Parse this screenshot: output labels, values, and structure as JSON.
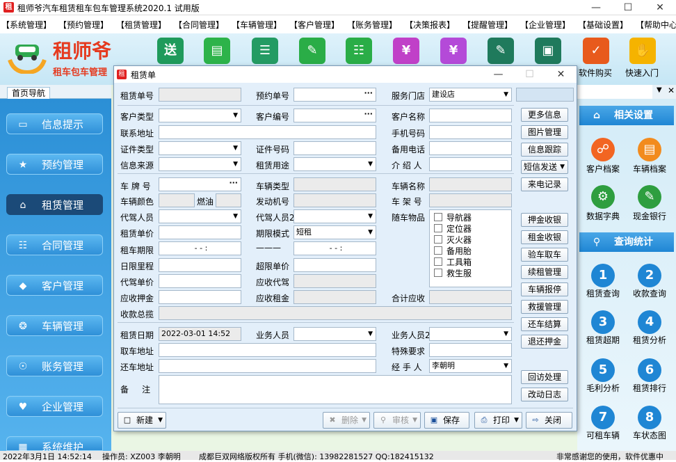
{
  "app": {
    "title": "租师爷汽车租赁租车包车管理系统2020.1 试用版"
  },
  "menu": [
    "【系统管理】",
    "【预约管理】",
    "【租赁管理】",
    "【合同管理】",
    "【车辆管理】",
    "【客户管理】",
    "【账务管理】",
    "【决策报表】",
    "【提醒管理】",
    "【企业管理】",
    "【基础设置】",
    "【帮助中心"
  ],
  "logo": {
    "name": "租师爷",
    "slogan": "租车包车管理"
  },
  "toolbar": {
    "buy": "软件购买",
    "guide": "快速入门"
  },
  "left": {
    "tab": "首页导航",
    "items": [
      "信息提示",
      "预约管理",
      "租赁管理",
      "合同管理",
      "客户管理",
      "车辆管理",
      "账务管理",
      "企业管理",
      "系统维护"
    ]
  },
  "right": {
    "settings": "相关设置",
    "stats": "查询统计",
    "settings_items": [
      "客户档案",
      "车辆档案",
      "数据字典",
      "现金银行"
    ],
    "stats_items": [
      "租赁查询",
      "收款查询",
      "租赁超期",
      "租赁分析",
      "毛利分析",
      "租赁排行",
      "可租车辆",
      "车状态图"
    ],
    "nums": [
      "1",
      "2",
      "3",
      "4",
      "5",
      "6",
      "7",
      "8"
    ]
  },
  "dialog": {
    "title": "租赁单",
    "labels": {
      "lease_no": "租赁单号",
      "reserve_no": "预约单号",
      "store": "服务门店",
      "cust_type": "客户类型",
      "cust_no": "客户编号",
      "cust_name": "客户名称",
      "address": "联系地址",
      "mobile": "手机号码",
      "id_type": "证件类型",
      "id_no": "证件号码",
      "backup_phone": "备用电话",
      "source": "信息来源",
      "purpose": "租赁用途",
      "introducer": "介 绍 人",
      "plate": "车 牌 号",
      "car_type": "车辆类型",
      "car_name": "车辆名称",
      "color": "车辆颜色",
      "fuel": "燃油",
      "engine": "发动机号",
      "frame": "车 架 号",
      "driver": "代驾人员",
      "driver2": "代驾人员2",
      "items": "随车物品",
      "unit_price": "租赁单价",
      "period_mode": "期限模式",
      "period": "租车期限",
      "dash": "———",
      "day_limit": "日限里程",
      "over_price": "超限单价",
      "driver_price": "代驾单价",
      "due_driver": "应收代驾",
      "deposit": "应收押金",
      "due_rent": "应收租金",
      "total_due": "合计应收",
      "total_collect": "收款总揽",
      "lease_date": "租赁日期",
      "sales": "业务人员",
      "sales2": "业务人员2",
      "pickup": "取车地址",
      "special": "特殊要求",
      "return_addr": "还车地址",
      "handler": "经 手 人",
      "remark": "备     注"
    },
    "values": {
      "store": "建设店",
      "period_mode": "短租",
      "period_start": "-  -     :",
      "period_end": "-  -     :",
      "lease_date": "2022-03-01 14:52",
      "handler": "李朝明"
    },
    "items_list": [
      "导航器",
      "定位器",
      "灭火器",
      "备用胎",
      "工具箱",
      "救生服"
    ],
    "side_buttons": [
      "更多信息",
      "图片管理",
      "信息跟踪",
      "短信发送",
      "来电记录",
      "押金收银",
      "租金收银",
      "验车取车",
      "续租管理",
      "车辆报停",
      "救援管理",
      "还车结算",
      "退还押金",
      "回访处理",
      "改动日志"
    ],
    "bottom": {
      "new": "新建",
      "delete": "删除",
      "audit": "审核",
      "save": "保存",
      "print": "打印",
      "close": "关闭"
    }
  },
  "status": {
    "date": "2022年3月1日  14:52:14",
    "operator": "操作员: XZ003  李朝明",
    "copyright": "成都巨双网络版权所有 手机(微信): 13982281527 QQ:182415132",
    "thanks": "非常感谢您的使用，软件优惠中"
  }
}
